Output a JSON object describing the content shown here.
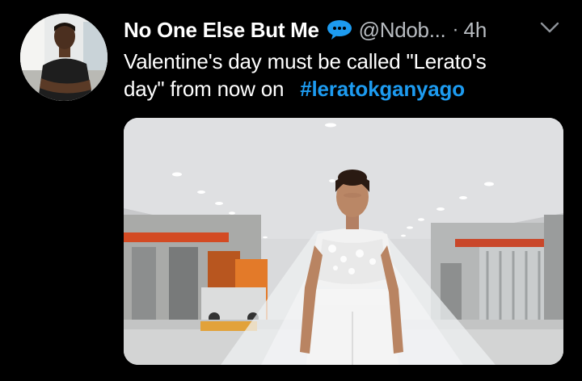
{
  "tweet": {
    "display_name": "No One Else But Me",
    "handle": "@Ndob...",
    "separator": "·",
    "time": "4h",
    "text_line1": "Valentine's day must be called  \"Lerato's",
    "text_line2": "day\" from now on",
    "hashtag": "#leratokganyago",
    "verified_icon": "speech-bubble-icon",
    "menu_icon": "chevron-down-icon"
  },
  "colors": {
    "background": "#000000",
    "hashtag": "#1d9bf0",
    "muted_text": "#b8bcc1",
    "verified": "#1d9bf0"
  }
}
